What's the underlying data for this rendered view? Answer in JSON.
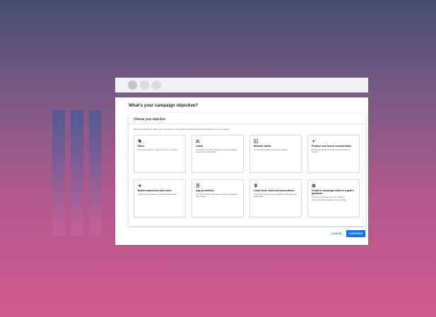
{
  "page": {
    "title": "What's your campaign objective?",
    "section_title": "Choose your objective",
    "instructions": "Select an objective to tailor your experience to the goals and settings that will work best for your campaign"
  },
  "objectives": [
    {
      "title": "Sales",
      "description": "Drive sales online, in app, by phone, or in store",
      "icon": "tag-icon"
    },
    {
      "title": "Leads",
      "description": "Get leads and other conversions by encouraging customers to take action",
      "icon": "people-icon"
    },
    {
      "title": "Website traffic",
      "description": "Get the right people to visit your website",
      "icon": "cursor-click-icon"
    },
    {
      "title": "Product and brand consideration",
      "description": "Encourage people to explore your products or services",
      "icon": "sparkle-icon"
    },
    {
      "title": "Brand awareness and reach",
      "description": "Reach a broad audience and build awareness",
      "icon": "megaphone-icon"
    },
    {
      "title": "App promotion",
      "description": "Get more installs, interactions and pre-registration for your app",
      "icon": "phone-icon"
    },
    {
      "title": "Local store visits and promotions",
      "description": "Drive visits to local stores including restaurants and dealerships",
      "icon": "location-pin-icon"
    },
    {
      "title": "Create a campaign without a goal's guidance",
      "description": "Choose a campaign type first, without a recommendation based on your objective",
      "icon": "gear-icon"
    }
  ],
  "actions": {
    "cancel_label": "CANCEL",
    "continue_label": "CONTINUE"
  },
  "colors": {
    "accent": "#1a73e8"
  }
}
